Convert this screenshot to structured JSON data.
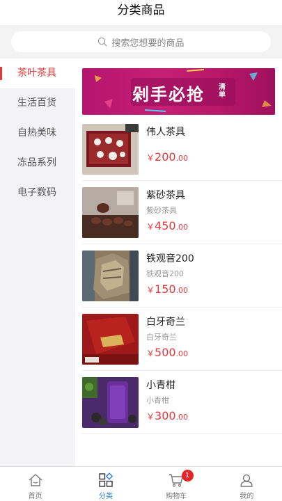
{
  "header": {
    "title": "分类商品"
  },
  "search": {
    "placeholder": "搜索您想要的商品"
  },
  "sidebar": {
    "items": [
      {
        "label": "茶叶茶具",
        "active": true
      },
      {
        "label": "生活百货",
        "active": false
      },
      {
        "label": "自热美味",
        "active": false
      },
      {
        "label": "冻品系列",
        "active": false
      },
      {
        "label": "电子数码",
        "active": false
      }
    ]
  },
  "banner": {
    "text": "剁手必抢",
    "sub": "清单"
  },
  "products": [
    {
      "name": "伟人茶具",
      "subtitle": "",
      "yen": "￥",
      "price_int": "200",
      "price_dec": ".00"
    },
    {
      "name": "紫砂茶具",
      "subtitle": "紫砂茶具",
      "yen": "￥",
      "price_int": "450",
      "price_dec": ".00"
    },
    {
      "name": "铁观音200",
      "subtitle": "铁观音200",
      "yen": "￥",
      "price_int": "150",
      "price_dec": ".00"
    },
    {
      "name": "白牙奇兰",
      "subtitle": "白牙奇兰",
      "yen": "￥",
      "price_int": "500",
      "price_dec": ".00"
    },
    {
      "name": "小青柑",
      "subtitle": "小青柑",
      "yen": "￥",
      "price_int": "300",
      "price_dec": ".00"
    }
  ],
  "tabbar": {
    "items": [
      {
        "label": "首页",
        "icon": "home-icon"
      },
      {
        "label": "分类",
        "icon": "category-icon",
        "active": true
      },
      {
        "label": "购物车",
        "icon": "cart-icon",
        "badge": "1"
      },
      {
        "label": "我的",
        "icon": "user-icon"
      }
    ]
  },
  "colors": {
    "accent": "#e4393c",
    "tab_active": "#2f7fd8",
    "sidebar_bg": "#f3f3f5"
  }
}
